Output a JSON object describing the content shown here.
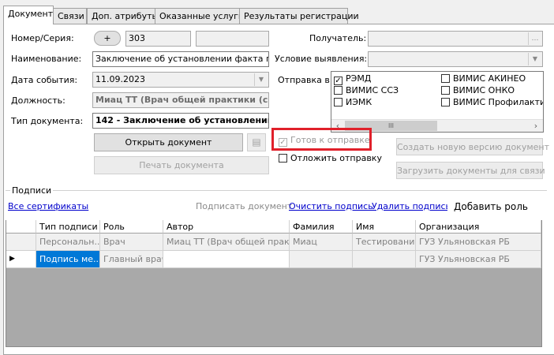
{
  "tabs": [
    "Документ",
    "Связи",
    "Доп. атрибуты",
    "Оказанные услуги",
    "Результаты регистрации"
  ],
  "form": {
    "number_label": "Номер/Серия:",
    "plus_label": "+",
    "number_value": "303",
    "series_value": "",
    "name_label": "Наименование:",
    "name_value": "Заключение об установлении факта поства",
    "date_label": "Дата события:",
    "date_value": "11.09.2023",
    "position_label": "Должность:",
    "position_value": "Миац ТТ (Врач общей практики (с",
    "doc_type_label": "Тип документа:",
    "doc_type_value": "142 - Заключение об установлении",
    "recipient_label": "Получатель:",
    "condition_label": "Условие выявления:",
    "send_to_label": "Отправка в"
  },
  "send_targets": [
    {
      "label": "РЭМД",
      "checked": true
    },
    {
      "label": "ВИМИС АКИНЕО",
      "checked": false
    },
    {
      "label": "ВИМИС ССЗ",
      "checked": false
    },
    {
      "label": "ВИМИС ОНКО",
      "checked": false
    },
    {
      "label": "ИЭМК",
      "checked": false
    },
    {
      "label": "ВИМИС Профилактика",
      "checked": false
    }
  ],
  "scroll_thumb_glyph": "III",
  "buttons": {
    "open_doc": "Открыть документ",
    "print_doc": "Печать документа",
    "create_version": "Создать новую версию документ",
    "upload_docs": "Загрузить документы для связи",
    "ready_to_send": "Готов к отправке",
    "postpone_send": "Отложить отправку"
  },
  "signatures": {
    "group_label": "Подписи",
    "all_certs": "Все сертификаты",
    "sign_doc": "Подписать документ",
    "clear_sign": "Очистить подпись",
    "delete_sign": "Удалить подпись",
    "add_role": "Добавить роль",
    "columns": [
      "Тип подписи",
      "Роль",
      "Автор",
      "Фамилия",
      "Имя",
      "Организация"
    ],
    "rows": [
      [
        "Персональн...",
        "Врач",
        "Миац ТТ (Врач общей практ...",
        "Миац",
        "Тестирование",
        "ГУЗ Ульяновская РБ"
      ],
      [
        "Подпись ме...",
        "Главный врач",
        "",
        "",
        "",
        "ГУЗ Ульяновская РБ"
      ]
    ]
  },
  "colors": {
    "highlight": "#e0202a",
    "selection": "#0078d7",
    "link": "#0000cc"
  }
}
